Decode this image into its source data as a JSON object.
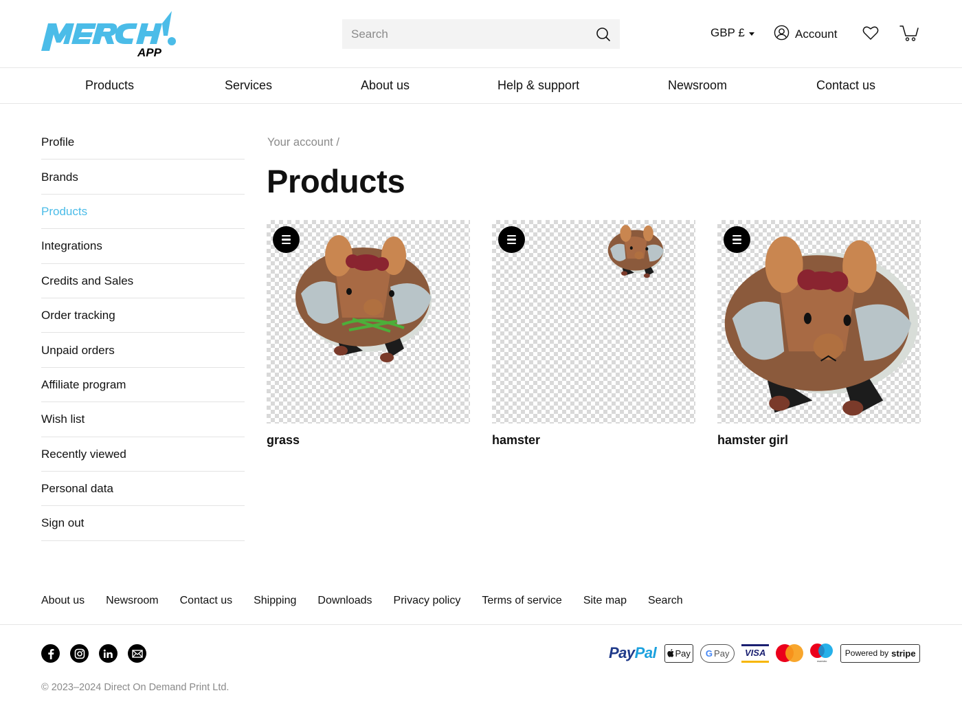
{
  "brand": {
    "logo_main": "MERCH",
    "logo_sub": "APP",
    "accent_color": "#4bbce8"
  },
  "header": {
    "search": {
      "placeholder": "Search",
      "value": "",
      "icon": "search-icon"
    },
    "currency": {
      "label": "GBP £",
      "icon": "chevron-down-icon"
    },
    "account": {
      "label": "Account",
      "icon": "user-circle-icon"
    },
    "wishlist_icon": "heart-icon",
    "cart_icon": "cart-icon"
  },
  "main_nav": [
    {
      "label": "Products"
    },
    {
      "label": "Services"
    },
    {
      "label": "About us"
    },
    {
      "label": "Help & support"
    },
    {
      "label": "Newsroom"
    },
    {
      "label": "Contact us"
    }
  ],
  "sidebar": {
    "active": "Products",
    "items": [
      {
        "label": "Profile"
      },
      {
        "label": "Brands"
      },
      {
        "label": "Products"
      },
      {
        "label": "Integrations"
      },
      {
        "label": "Credits and Sales"
      },
      {
        "label": "Order tracking"
      },
      {
        "label": "Unpaid orders"
      },
      {
        "label": "Affiliate program"
      },
      {
        "label": "Wish list"
      },
      {
        "label": "Recently viewed"
      },
      {
        "label": "Personal data"
      },
      {
        "label": "Sign out"
      }
    ]
  },
  "breadcrumb": {
    "parent": "Your account",
    "separator": "/"
  },
  "page_title": "Products",
  "products": [
    {
      "name": "grass",
      "menu_icon": "menu-icon",
      "image": "hamster-with-grass"
    },
    {
      "name": "hamster",
      "menu_icon": "menu-icon",
      "image": "small-hamster"
    },
    {
      "name": "hamster girl",
      "menu_icon": "menu-icon",
      "image": "hamster-with-bow"
    }
  ],
  "footer": {
    "links": [
      {
        "label": "About us"
      },
      {
        "label": "Newsroom"
      },
      {
        "label": "Contact us"
      },
      {
        "label": "Shipping"
      },
      {
        "label": "Downloads"
      },
      {
        "label": "Privacy policy"
      },
      {
        "label": "Terms of service"
      },
      {
        "label": "Site map"
      },
      {
        "label": "Search"
      }
    ],
    "social": [
      "facebook-icon",
      "instagram-icon",
      "linkedin-icon",
      "email-icon"
    ],
    "payments": {
      "paypal_a": "Pay",
      "paypal_b": "Pal",
      "apple_pay": "Pay",
      "google_pay": "Pay",
      "visa": "VISA",
      "maestro": "maestro",
      "stripe_prefix": "Powered by",
      "stripe_name": "stripe"
    },
    "copyright": "© 2023–2024 Direct On Demand Print Ltd."
  }
}
